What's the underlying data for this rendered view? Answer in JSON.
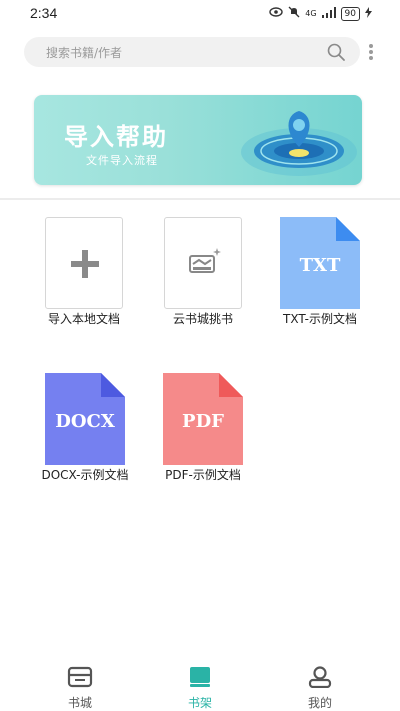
{
  "status_bar": {
    "time": "2:34",
    "network": "4G",
    "battery": "90"
  },
  "search": {
    "placeholder": "搜索书籍/作者"
  },
  "banner": {
    "title": "导入帮助",
    "subtitle": "文件导入流程"
  },
  "shelf": {
    "items": [
      {
        "label": "导入本地文档",
        "kind": "action"
      },
      {
        "label": "云书城挑书",
        "kind": "action"
      },
      {
        "label": "TXT-示例文档",
        "kind": "file",
        "file_type": "TXT",
        "color": "#8cbcf8",
        "fold_color": "#3d8cf0"
      },
      {
        "label": "DOCX-示例文档",
        "kind": "file",
        "file_type": "DOCX",
        "color": "#7580f0",
        "fold_color": "#4d5ae0"
      },
      {
        "label": "PDF-示例文档",
        "kind": "file",
        "file_type": "PDF",
        "color": "#f58a8a",
        "fold_color": "#ef5a5a"
      }
    ]
  },
  "tabbar": {
    "tabs": [
      {
        "label": "书城",
        "icon": "store-icon",
        "active": false
      },
      {
        "label": "书架",
        "icon": "bookshelf-icon",
        "active": true
      },
      {
        "label": "我的",
        "icon": "profile-icon",
        "active": false
      }
    ],
    "active_color": "#2ab3a6",
    "inactive_color": "#555555"
  }
}
